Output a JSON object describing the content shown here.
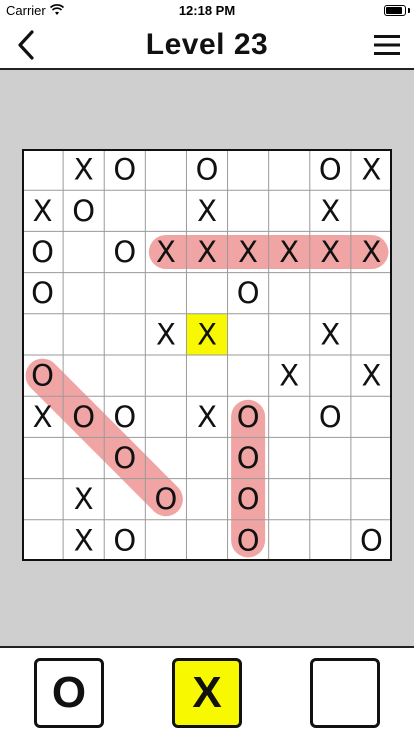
{
  "status_bar": {
    "carrier": "Carrier",
    "time": "12:18 PM"
  },
  "header": {
    "title": "Level 23"
  },
  "icons": {
    "back": "chevron-left-icon",
    "menu": "hamburger-menu-icon",
    "wifi": "wifi-icon",
    "battery": "battery-icon"
  },
  "colors": {
    "highlight_cell": "#f8f800",
    "win_line": "#f0a0a0",
    "game_bg": "#cfcfcf"
  },
  "board": {
    "rows": 10,
    "cols": 9,
    "cells": [
      [
        "",
        "X",
        "O",
        "",
        "O",
        "",
        "",
        "O",
        "X"
      ],
      [
        "X",
        "O",
        "",
        "",
        "X",
        "",
        "",
        "X",
        ""
      ],
      [
        "O",
        "",
        "O",
        "X",
        "X",
        "X",
        "X",
        "X",
        "X"
      ],
      [
        "O",
        "",
        "",
        "",
        "",
        "O",
        "",
        "",
        ""
      ],
      [
        "",
        "",
        "",
        "X",
        "X",
        "",
        "",
        "X",
        ""
      ],
      [
        "O",
        "",
        "",
        "",
        "",
        "",
        "X",
        "",
        "X"
      ],
      [
        "X",
        "O",
        "O",
        "",
        "X",
        "O",
        "",
        "O",
        ""
      ],
      [
        "",
        "",
        "O",
        "",
        "",
        "O",
        "",
        "",
        ""
      ],
      [
        "",
        "X",
        "",
        "O",
        "",
        "O",
        "",
        "",
        ""
      ],
      [
        "",
        "X",
        "O",
        "",
        "",
        "O",
        "",
        "",
        "O"
      ]
    ],
    "highlighted_cell": {
      "row": 4,
      "col": 4
    },
    "win_lines": [
      {
        "from": [
          2,
          3
        ],
        "to": [
          2,
          8
        ]
      },
      {
        "from": [
          5,
          0
        ],
        "to": [
          8,
          3
        ]
      },
      {
        "from": [
          6,
          5
        ],
        "to": [
          9,
          5
        ]
      }
    ]
  },
  "piece_buttons": [
    {
      "label": "O",
      "selected": false
    },
    {
      "label": "X",
      "selected": true
    },
    {
      "label": "",
      "selected": false
    }
  ]
}
